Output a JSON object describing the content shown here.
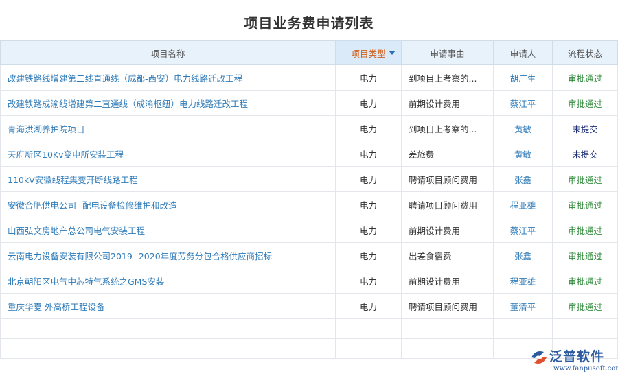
{
  "page": {
    "title": "项目业务费申请列表"
  },
  "table": {
    "columns": [
      "项目名称",
      "项目类型",
      "申请事由",
      "申请人",
      "流程状态"
    ],
    "rows": [
      {
        "name": "改建铁路线增建第二线直通线（成都-西安）电力线路迁改工程",
        "type": "电力",
        "reason": "到项目上考察的...",
        "person": "胡广生",
        "status": "审批通过"
      },
      {
        "name": "改建铁路成渝线增建第二直通线（成渝枢纽）电力线路迁改工程",
        "type": "电力",
        "reason": "前期设计费用",
        "person": "蔡江平",
        "status": "审批通过"
      },
      {
        "name": "青海洪湖养护院项目",
        "type": "电力",
        "reason": "到项目上考察的...",
        "person": "黄敏",
        "status": "未提交"
      },
      {
        "name": "天府新区10Kv变电所安装工程",
        "type": "电力",
        "reason": "差旅费",
        "person": "黄敏",
        "status": "未提交"
      },
      {
        "name": "110kV安徽线程集变开断线路工程",
        "type": "电力",
        "reason": "聘请项目顾问费用",
        "person": "张鑫",
        "status": "审批通过"
      },
      {
        "name": "安徽合肥供电公司--配电设备检修维护和改造",
        "type": "电力",
        "reason": "聘请项目顾问费用",
        "person": "程亚雄",
        "status": "审批通过"
      },
      {
        "name": "山西弘文房地产总公司电气安装工程",
        "type": "电力",
        "reason": "前期设计费用",
        "person": "蔡江平",
        "status": "审批通过"
      },
      {
        "name": "云南电力设备安装有限公司2019--2020年度劳务分包合格供应商招标",
        "type": "电力",
        "reason": "出差食宿费",
        "person": "张鑫",
        "status": "审批通过"
      },
      {
        "name": "北京朝阳区电气中芯特气系统之GMS安装",
        "type": "电力",
        "reason": "前期设计费用",
        "person": "程亚雄",
        "status": "审批通过"
      },
      {
        "name": "重庆华夏 外高桥工程设备",
        "type": "电力",
        "reason": "聘请项目顾问费用",
        "person": "董清平",
        "status": "审批通过"
      }
    ]
  },
  "logo": {
    "brand": "泛普软件",
    "url": "www.fanpusoft.com"
  },
  "colors": {
    "header_bg": "#e8f2fb",
    "link": "#2f7bb8",
    "approved": "#2f8a3a",
    "pending": "#1a2c72",
    "active_header": "#d35f1c"
  }
}
